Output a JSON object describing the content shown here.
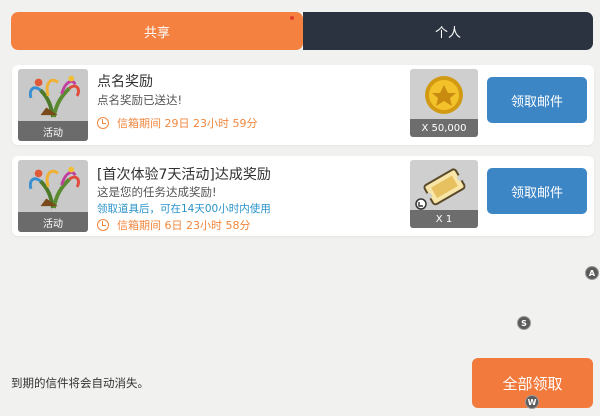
{
  "tabs": [
    {
      "label": "共享",
      "active": true
    },
    {
      "label": "个人",
      "active": false
    }
  ],
  "mails": [
    {
      "thumb_label": "活动",
      "title": "点名奖励",
      "subtitle": "点名奖励已送达!",
      "note": "",
      "expiry": "信箱期间 29日 23小时 59分",
      "reward_label": "X 50,000",
      "reward_icon": "gold-coin-icon",
      "claim_label": "领取邮件"
    },
    {
      "thumb_label": "活动",
      "title": "[首次体验7天活动]达成奖励",
      "subtitle": "这是您的任务达成奖励!",
      "note": "领取道具后，可在14天00小时内使用",
      "expiry": "信箱期间 6日 23小时 58分",
      "reward_label": "X 1",
      "reward_icon": "ticket-icon",
      "claim_label": "领取邮件"
    }
  ],
  "footer": {
    "note": "到期的信件将会自动消失。",
    "claim_all_label": "全部领取"
  },
  "hints": {
    "a": "A",
    "s": "S",
    "w": "W"
  },
  "colors": {
    "accent_orange": "#f4813f",
    "dark_tab": "#2b3340",
    "claim_blue": "#3d86c6",
    "expiry_orange": "#f0873e",
    "note_blue": "#2a93c9"
  }
}
